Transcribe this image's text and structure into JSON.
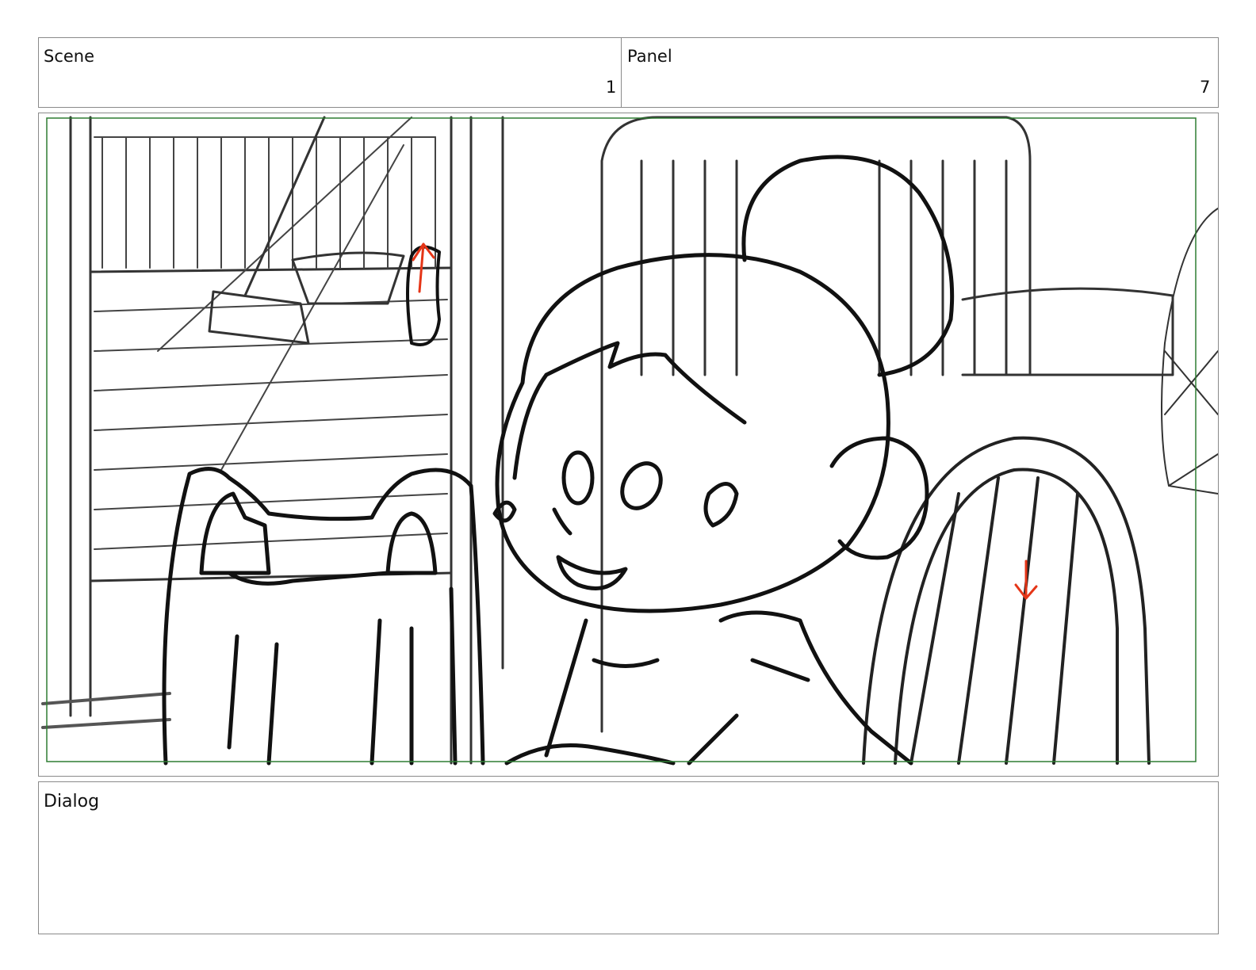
{
  "header": {
    "scene_label": "Scene",
    "scene_number": "1",
    "panel_label": "Panel",
    "panel_number": "7"
  },
  "panel": {
    "safe_frame_color": "#2e7d32",
    "arrow_color": "#e53517",
    "ink_color": "#111111"
  },
  "dialog": {
    "label": "Dialog"
  }
}
